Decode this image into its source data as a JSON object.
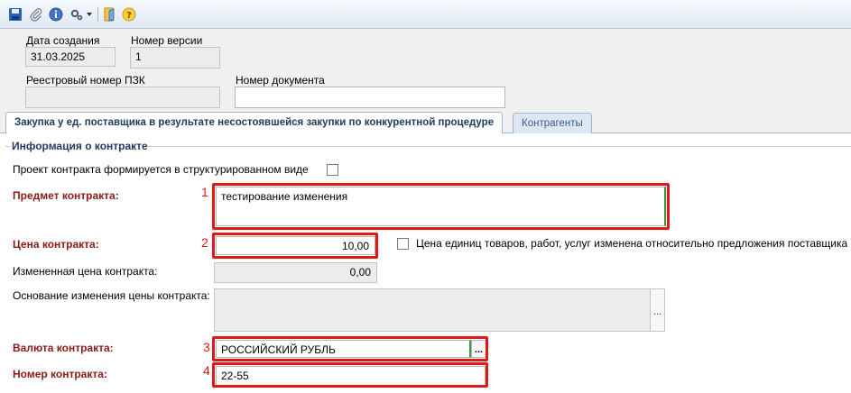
{
  "toolbar": {
    "icons": [
      "save-icon",
      "attachment-icon",
      "info-icon",
      "settings-icon",
      "dropdown-arrow-icon",
      "exit-icon",
      "help-icon"
    ]
  },
  "header": {
    "creation_date_label": "Дата создания",
    "creation_date_value": "31.03.2025",
    "version_label": "Номер версии",
    "version_value": "1",
    "registry_number_label": "Реестровый номер ПЗК",
    "registry_number_value": "",
    "document_number_label": "Номер документа",
    "document_number_value": ""
  },
  "tabs": [
    {
      "label": "Закупка у ед. поставщика в результате несостоявшейся закупки по конкурентной процедуре",
      "active": true
    },
    {
      "label": "Контрагенты",
      "active": false
    }
  ],
  "contract_info": {
    "group_title": "Информация о контракте",
    "structured_label": "Проект контракта формируется в структурированном виде",
    "structured_checked": false,
    "subject_label": "Предмет контракта:",
    "subject_value": "тестирование изменения",
    "price_label": "Цена контракта:",
    "price_value": "10,00",
    "unit_price_changed_label": "Цена единиц товаров, работ, услуг изменена относительно предложения поставщика",
    "unit_price_changed_checked": false,
    "changed_price_label": "Измененная цена контракта:",
    "changed_price_value": "0,00",
    "price_change_basis_label": "Основание изменения цены контракта:",
    "price_change_basis_value": "",
    "currency_label": "Валюта контракта:",
    "currency_value": "РОССИЙСКИЙ РУБЛЬ",
    "number_label": "Номер контракта:",
    "number_value": "22-55",
    "ellipsis": "..."
  },
  "callouts": [
    "1",
    "2",
    "3",
    "4"
  ],
  "colors": {
    "required_label": "#8b1a1a",
    "highlight_box": "#e01818",
    "tab_active_text": "#1e3a5f"
  }
}
